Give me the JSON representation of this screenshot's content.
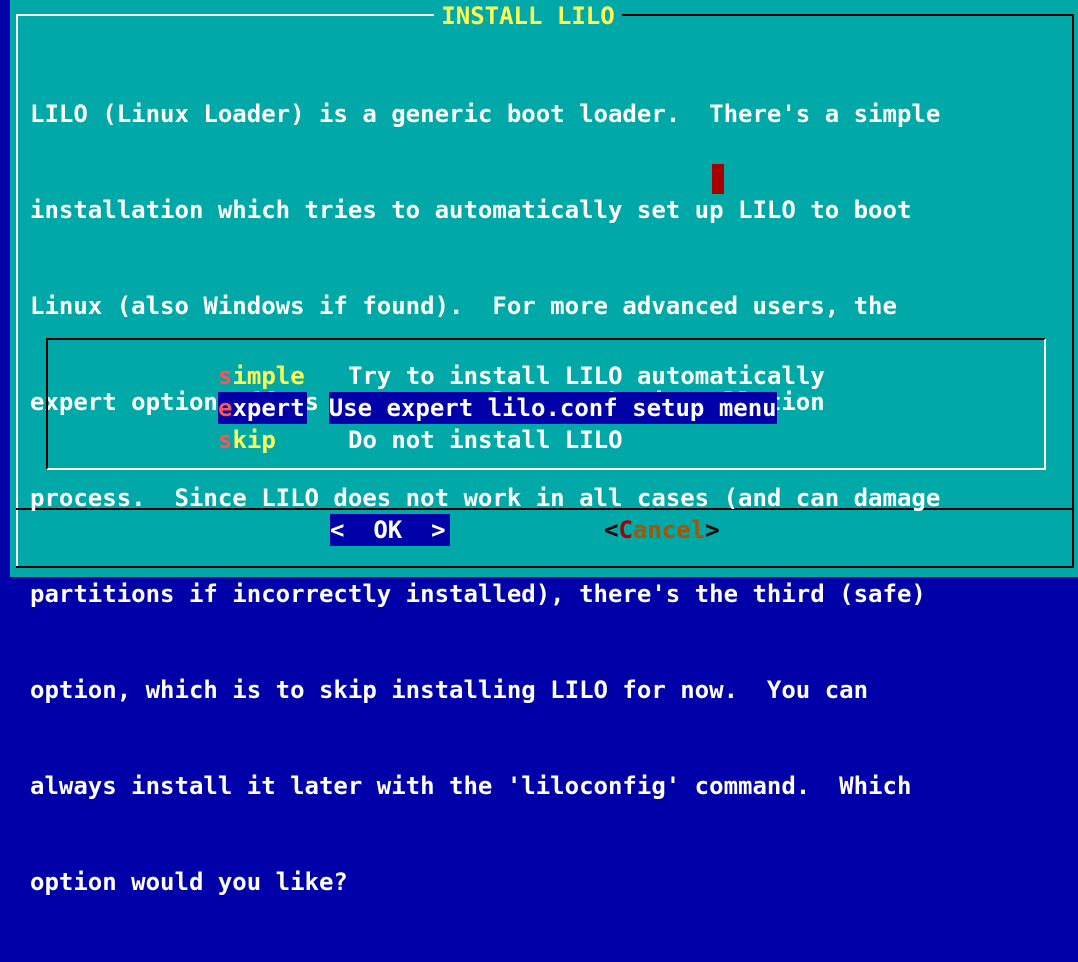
{
  "dialog": {
    "title": "INSTALL LILO",
    "message_lines": [
      "LILO (Linux Loader) is a generic boot loader.  There's a simple",
      "installation which tries to automatically set up LILO to boot",
      "Linux (also Windows if found).  For more advanced users, the",
      "expert option offers more control over the installation",
      "process.  Since LILO does not work in all cases (and can damage",
      "partitions if incorrectly installed), there's the third (safe)",
      "option, which is to skip installing LILO for now.  You can",
      "always install it later with the 'liloconfig' command.  Which",
      "option would you like?"
    ]
  },
  "menu": {
    "items": [
      {
        "hotkey": "s",
        "rest": "imple",
        "description": "Try to install LILO automatically"
      },
      {
        "hotkey": "e",
        "rest": "xpert",
        "description": "Use expert lilo.conf setup menu"
      },
      {
        "hotkey": "s",
        "rest": "kip",
        "description": "Do not install LILO"
      }
    ],
    "selected_index": 1
  },
  "buttons": {
    "ok": {
      "label": "<  OK  >"
    },
    "cancel": {
      "open": "<",
      "hotkey": "C",
      "rest": "ancel",
      "close": ">"
    }
  },
  "colors": {
    "screen_background": "#0000a8",
    "dialog_background": "#00a8a8",
    "title_text": "#ffff54",
    "body_text": "#ffffff",
    "hotkey": "#ff5454",
    "selection_background": "#0000a8"
  }
}
